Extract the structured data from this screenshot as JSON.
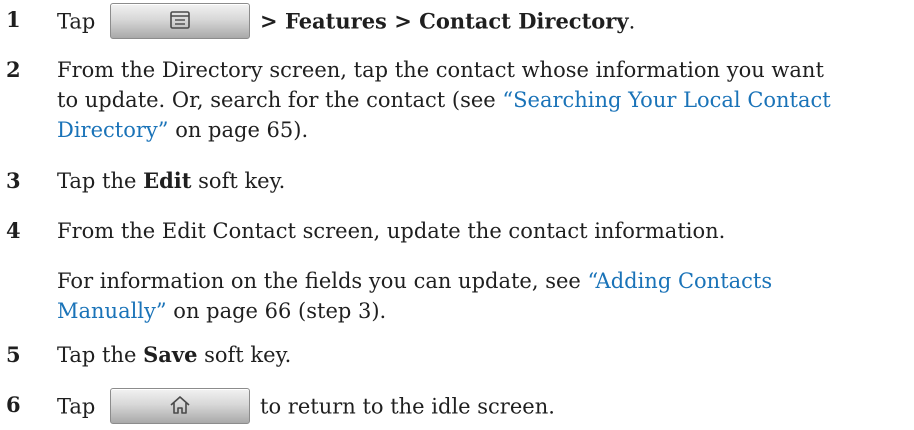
{
  "steps": [
    {
      "num": "1",
      "pre": "Tap",
      "button_icon": "menu-icon",
      "bold": "> Features > Contact Directory",
      "post": "."
    },
    {
      "num": "2",
      "line1": "From the Directory screen, tap the contact whose information you want",
      "line2_a": "to update. Or, search for the contact (see ",
      "link1": "“Searching Your Local Contact",
      "link2": "Directory”",
      "line3_b": " on page 65)."
    },
    {
      "num": "3",
      "pre": "Tap the ",
      "bold": "Edit",
      "post": " soft key."
    },
    {
      "num": "4",
      "text": "From the Edit Contact screen, update the contact information.",
      "sub_a": "For information on the fields you can update, see ",
      "sub_link1": "“Adding Contacts",
      "sub_link2": "Manually”",
      "sub_b": " on page 66 (step 3)."
    },
    {
      "num": "5",
      "pre": "Tap the ",
      "bold": "Save",
      "post": " soft key."
    },
    {
      "num": "6",
      "pre": "Tap",
      "button_icon": "home-icon",
      "post": "to return to the idle screen."
    }
  ],
  "colors": {
    "text": "#1f1f1f",
    "link": "#1a73b8"
  }
}
